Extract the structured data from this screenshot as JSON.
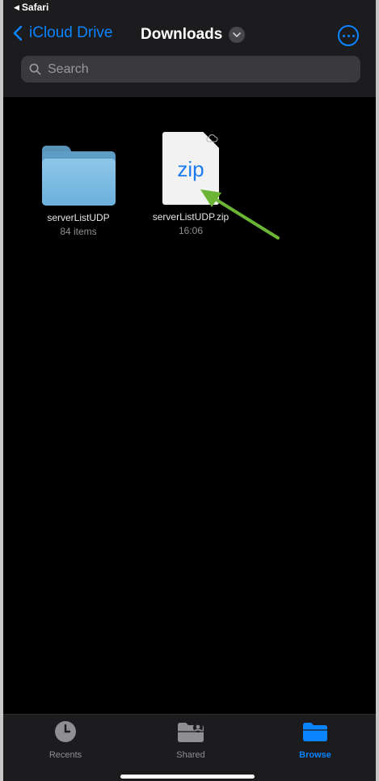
{
  "status_bar": {
    "back_app": "Safari"
  },
  "nav": {
    "back_label": "iCloud Drive",
    "title": "Downloads"
  },
  "search": {
    "placeholder": "Search"
  },
  "items": [
    {
      "name": "serverListUDP",
      "sub": "84 items",
      "type": "folder"
    },
    {
      "name": "serverListUDP.zip",
      "sub": "16:06",
      "type": "zip",
      "badge": "zip"
    }
  ],
  "annotation": {
    "arrow_color": "#6bb536"
  },
  "tabs": [
    {
      "label": "Recents",
      "icon": "clock-icon"
    },
    {
      "label": "Shared",
      "icon": "shared-folder-icon"
    },
    {
      "label": "Browse",
      "icon": "folder-icon",
      "active": true
    }
  ],
  "colors": {
    "accent": "#0a84ff",
    "background": "#000000",
    "bar": "#1c1c1e"
  }
}
